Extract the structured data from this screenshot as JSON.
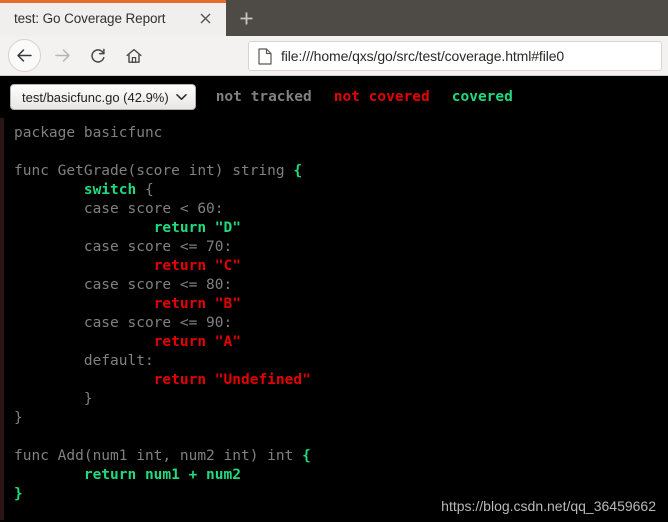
{
  "browser": {
    "tab": {
      "title": "test: Go Coverage Report",
      "close_label": "×"
    },
    "newtab_label": "+",
    "nav": {
      "back_label": "Back",
      "forward_label": "Forward",
      "reload_label": "Reload",
      "home_label": "Home"
    },
    "url": "file:///home/qxs/go/src/test/coverage.html#file0"
  },
  "coverage": {
    "file_select": {
      "value": "test/basicfunc.go (42.9%)",
      "caret": "⌄"
    },
    "legend": [
      {
        "label": "not tracked",
        "color": "#808080"
      },
      {
        "label": "not covered",
        "color": "#e50000"
      },
      {
        "label": "covered",
        "color": "#21d97f"
      }
    ],
    "colors": {
      "background": "#000000",
      "not_tracked": "#808080",
      "not_covered": "#e50000",
      "covered": "#21d97f",
      "browser_accent": "#e66c2c"
    },
    "code_lines": [
      {
        "segments": [
          {
            "text": "package basicfunc",
            "cov": "cov0"
          }
        ]
      },
      {
        "segments": [
          {
            "text": "",
            "cov": "cov0"
          }
        ]
      },
      {
        "segments": [
          {
            "text": "func GetGrade(score int) string ",
            "cov": "cov0"
          },
          {
            "text": "{",
            "cov": "cov-hit"
          }
        ]
      },
      {
        "segments": [
          {
            "text": "        ",
            "cov": "cov0"
          },
          {
            "text": "switch",
            "cov": "cov-hit"
          },
          {
            "text": " {",
            "cov": "cov0"
          }
        ]
      },
      {
        "segments": [
          {
            "text": "        case score < 60:",
            "cov": "cov0"
          }
        ]
      },
      {
        "segments": [
          {
            "text": "                ",
            "cov": "cov0"
          },
          {
            "text": "return \"D\"",
            "cov": "cov-hit"
          }
        ]
      },
      {
        "segments": [
          {
            "text": "        case score <= 70:",
            "cov": "cov0"
          }
        ]
      },
      {
        "segments": [
          {
            "text": "                ",
            "cov": "cov0"
          },
          {
            "text": "return \"C\"",
            "cov": "cov-none"
          }
        ]
      },
      {
        "segments": [
          {
            "text": "        case score <= 80:",
            "cov": "cov0"
          }
        ]
      },
      {
        "segments": [
          {
            "text": "                ",
            "cov": "cov0"
          },
          {
            "text": "return \"B\"",
            "cov": "cov-none"
          }
        ]
      },
      {
        "segments": [
          {
            "text": "        case score <= 90:",
            "cov": "cov0"
          }
        ]
      },
      {
        "segments": [
          {
            "text": "                ",
            "cov": "cov0"
          },
          {
            "text": "return \"A\"",
            "cov": "cov-none"
          }
        ]
      },
      {
        "segments": [
          {
            "text": "        default:",
            "cov": "cov0"
          }
        ]
      },
      {
        "segments": [
          {
            "text": "                ",
            "cov": "cov0"
          },
          {
            "text": "return \"Undefined\"",
            "cov": "cov-none"
          }
        ]
      },
      {
        "segments": [
          {
            "text": "        }",
            "cov": "cov0"
          }
        ]
      },
      {
        "segments": [
          {
            "text": "}",
            "cov": "cov0"
          }
        ]
      },
      {
        "segments": [
          {
            "text": "",
            "cov": "cov0"
          }
        ]
      },
      {
        "segments": [
          {
            "text": "func Add(num1 int, num2 int) int ",
            "cov": "cov0"
          },
          {
            "text": "{",
            "cov": "cov-hit"
          }
        ]
      },
      {
        "segments": [
          {
            "text": "        ",
            "cov": "cov0"
          },
          {
            "text": "return num1 + num2",
            "cov": "cov-hit"
          }
        ]
      },
      {
        "segments": [
          {
            "text": "}",
            "cov": "cov-hit"
          }
        ]
      }
    ]
  },
  "watermark": "https://blog.csdn.net/qq_36459662"
}
